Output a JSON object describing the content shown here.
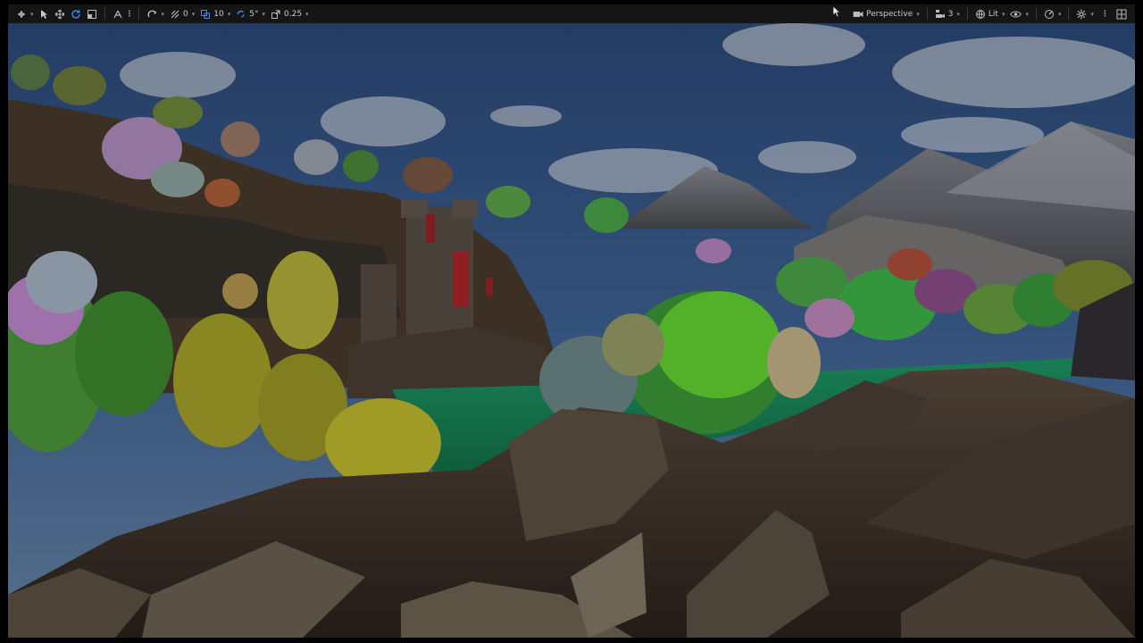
{
  "toolbar": {
    "left": {
      "grid_snap_value": "0",
      "location_snap_value": "10",
      "rotation_snap_value": "5°",
      "scale_snap_value": "0.25"
    },
    "right": {
      "view_mode_label": "Perspective",
      "camera_speed_value": "3",
      "lighting_mode_label": "Lit"
    },
    "icons": {
      "select": "select-arrow-icon",
      "translate": "move-icon",
      "rotate": "rotate-icon",
      "scale": "scale-icon",
      "settings": "gear-icon",
      "layout": "viewport-layout-icon"
    },
    "colors": {
      "toolbar_bg": "#151515",
      "accent": "#2f8fff"
    }
  }
}
